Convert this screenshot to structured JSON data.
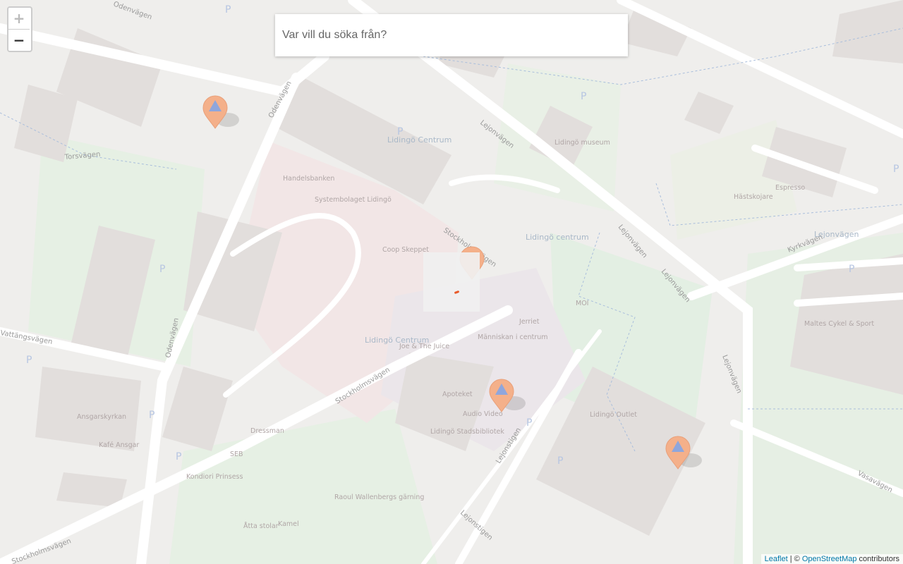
{
  "search": {
    "placeholder": "Var vill du söka från?"
  },
  "zoom": {
    "in_label": "+",
    "out_label": "−"
  },
  "attribution": {
    "leaflet": "Leaflet",
    "separator": " | © ",
    "osm": "OpenStreetMap",
    "suffix": " contributors"
  },
  "map": {
    "street_labels": [
      "Odenvägen",
      "Odenvägen",
      "Odenvägen",
      "Torsvägen",
      "Vattängsvägen",
      "Lejonvägen",
      "Lejonvägen",
      "Lejonvägen",
      "Lejonvägen",
      "Kyrkvägen",
      "Stockholmsvägen",
      "Stockholmsvägen",
      "Stockholmsvägen",
      "Lejonstigen",
      "Lejonstigen",
      "Vasavägen"
    ],
    "place_labels": [
      "Lidingö Centrum",
      "Lidingö Centrum",
      "Lidingö centrum",
      "Lidingö museum",
      "Handelsbanken",
      "Systembolaget Lidingö",
      "Coop Skeppet",
      "Människan i centrum",
      "Joe & The Juice",
      "Apoteket",
      "Audio Video",
      "Lidingö Stadsbibliotek",
      "Lidingö Outlet",
      "Dressman",
      "SEB",
      "Kondiori Prinsess",
      "Ansgarskyrkan",
      "Kafé Ansgar",
      "Raoul Wallenbergs gärning",
      "Åtta stolar",
      "Kamel",
      "Jerriet",
      "MOI",
      "Hästskojare",
      "Espresso",
      "Lejonvägen",
      "Maltes Cykel & Sport"
    ],
    "pins": [
      {
        "name": "pin-1",
        "color": "#f4b08a",
        "icon": "triangle-icon"
      },
      {
        "name": "pin-2",
        "color": "#f4b08a",
        "icon": "triangle-icon"
      },
      {
        "name": "pin-3",
        "color": "#f4b08a",
        "icon": "triangle-icon"
      },
      {
        "name": "pin-4",
        "color": "#f4b08a",
        "icon": "triangle-icon"
      }
    ]
  }
}
